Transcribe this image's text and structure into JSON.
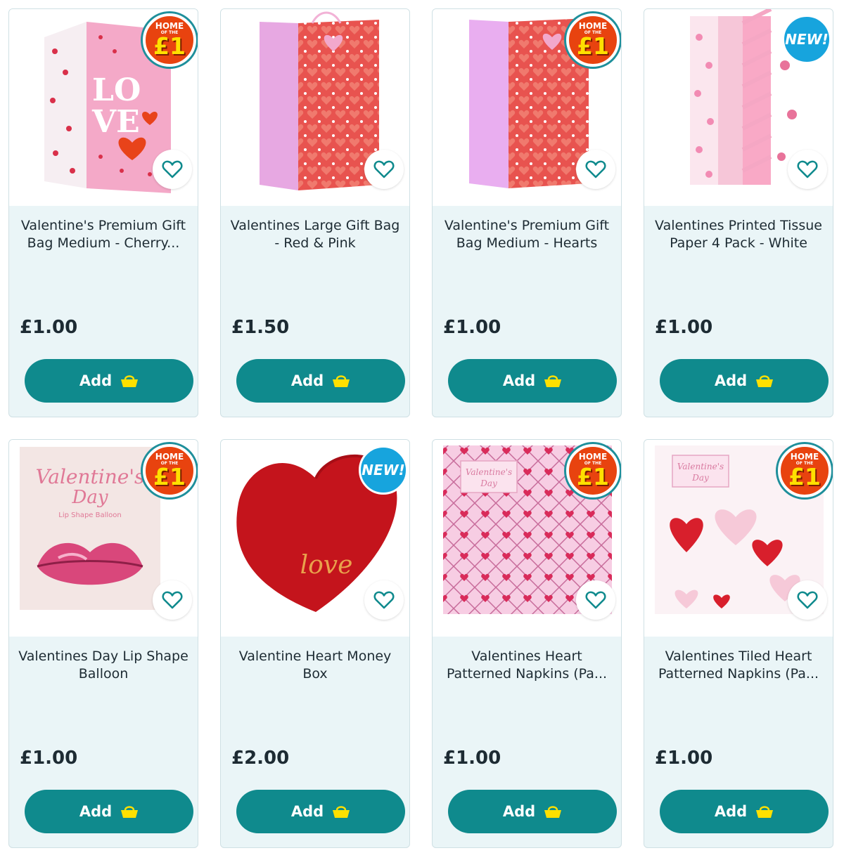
{
  "colors": {
    "accent": "#0f8a8d",
    "card_bg": "#eaf5f7",
    "hot_badge": "#e8430f",
    "new_badge": "#17a4dd",
    "basket": "#ffe000"
  },
  "products": [
    {
      "title": "Valentine's Premium Gift Bag Medium - Cherry...",
      "price": "£1.00",
      "add_label": "Add",
      "badge": "home_of_the_pound",
      "badge_text": {
        "top": "HOME",
        "mid": "OF THE",
        "main": "£1"
      },
      "image": "love-cherry-gift-bag"
    },
    {
      "title": "Valentines Large Gift Bag - Red & Pink",
      "price": "£1.50",
      "add_label": "Add",
      "badge": "none",
      "image": "red-pink-heart-gift-bag"
    },
    {
      "title": "Valentine's Premium Gift Bag Medium - Hearts",
      "price": "£1.00",
      "add_label": "Add",
      "badge": "home_of_the_pound",
      "badge_text": {
        "top": "HOME",
        "mid": "OF THE",
        "main": "£1"
      },
      "image": "hearts-gift-bag"
    },
    {
      "title": "Valentines Printed Tissue Paper 4 Pack - White",
      "price": "£1.00",
      "add_label": "Add",
      "badge": "new",
      "badge_text": {
        "main": "NEW!"
      },
      "image": "tissue-paper-pack"
    },
    {
      "title": "Valentines Day Lip Shape Balloon",
      "price": "£1.00",
      "add_label": "Add",
      "badge": "home_of_the_pound",
      "badge_text": {
        "top": "HOME",
        "mid": "OF THE",
        "main": "£1"
      },
      "image": "lip-balloon",
      "image_text": {
        "line1": "Valentine's",
        "line2": "Day",
        "line3": "Lip Shape Balloon"
      }
    },
    {
      "title": "Valentine Heart Money Box",
      "price": "£2.00",
      "add_label": "Add",
      "badge": "new",
      "badge_text": {
        "main": "NEW!"
      },
      "image": "heart-money-box",
      "image_text": {
        "line1": "love"
      }
    },
    {
      "title": "Valentines Heart Patterned Napkins (Pa...",
      "price": "£1.00",
      "add_label": "Add",
      "badge": "home_of_the_pound",
      "badge_text": {
        "top": "HOME",
        "mid": "OF THE",
        "main": "£1"
      },
      "image": "heart-lattice-napkins",
      "image_text": {
        "line1": "Valentine's",
        "line2": "Day"
      }
    },
    {
      "title": "Valentines Tiled Heart Patterned Napkins (Pa...",
      "price": "£1.00",
      "add_label": "Add",
      "badge": "home_of_the_pound",
      "badge_text": {
        "top": "HOME",
        "mid": "OF THE",
        "main": "£1"
      },
      "image": "tiled-heart-napkins",
      "image_text": {
        "line1": "Valentine's",
        "line2": "Day"
      }
    }
  ]
}
